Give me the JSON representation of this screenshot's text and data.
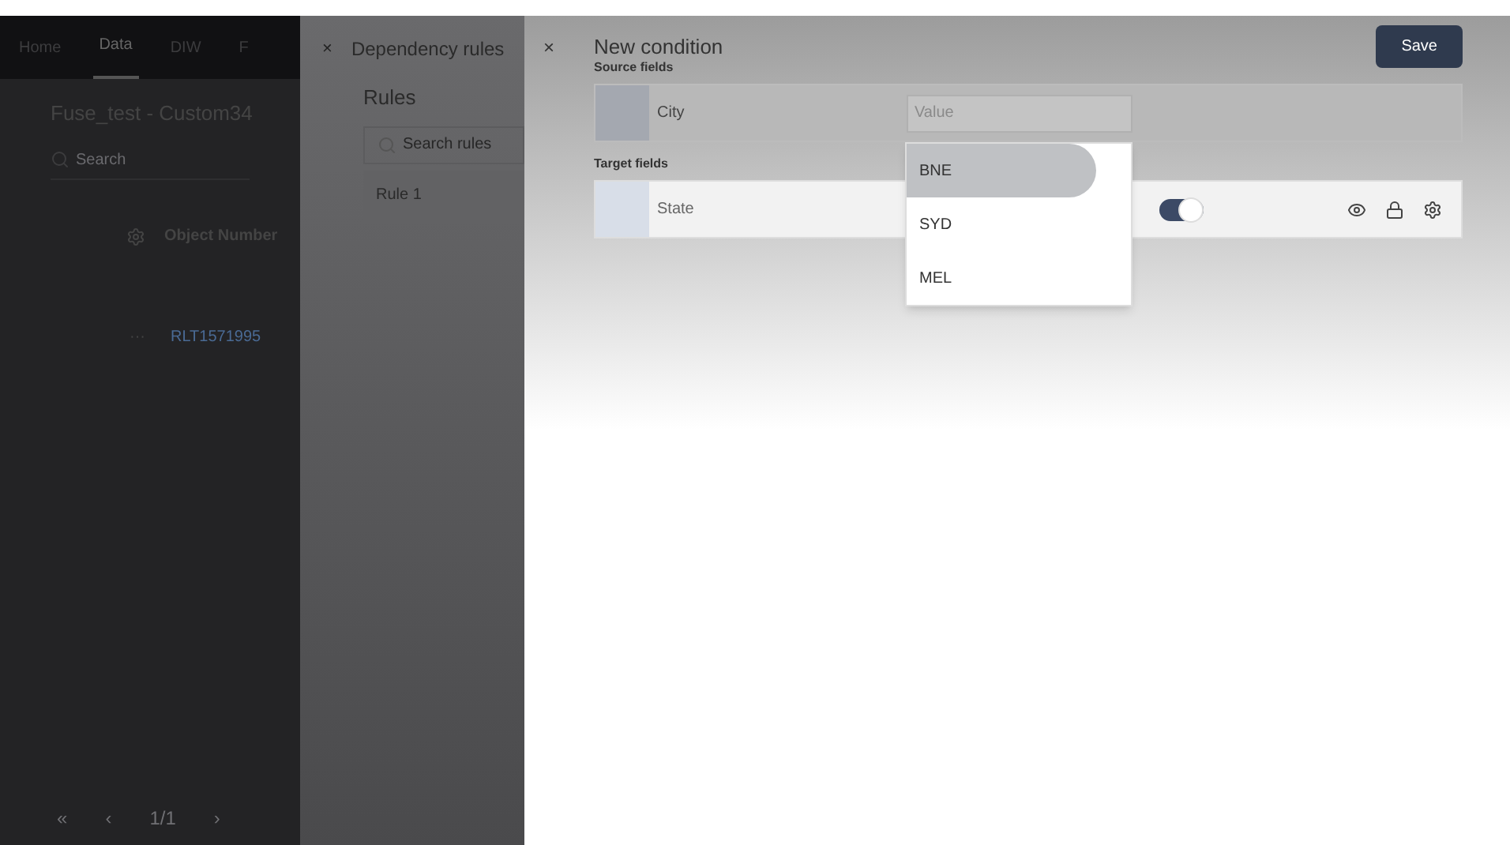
{
  "app_tabs": [
    {
      "label": "Home",
      "selected": false
    },
    {
      "label": "Data",
      "selected": true
    },
    {
      "label": "DIW",
      "selected": false
    },
    {
      "label": "F",
      "selected": false
    }
  ],
  "dataset_title": "Fuse_test - Custom34",
  "search": {
    "placeholder": "Search"
  },
  "table": {
    "columns": [
      "Object Number"
    ],
    "rows": [
      {
        "menu": "···",
        "object_number": "RLT1571995"
      }
    ]
  },
  "pagination": {
    "first": "«",
    "prev": "‹",
    "page": "1/1",
    "next": "›"
  },
  "rules_panel": {
    "close": "×",
    "title": "Dependency rules",
    "heading": "Rules",
    "search": {
      "placeholder": "Search rules"
    },
    "rules": [
      {
        "label": "Rule 1"
      }
    ]
  },
  "condition": {
    "close": "×",
    "title": "New condition",
    "save": "Save",
    "source_label": "Source fields",
    "source": {
      "name": "City",
      "value": {
        "placeholder": "Value"
      }
    },
    "target_label": "Target fields",
    "target": {
      "name": "State",
      "on": true
    },
    "options": [
      {
        "label": "BNE",
        "selected": true
      },
      {
        "label": "SYD",
        "selected": false
      },
      {
        "label": "MEL",
        "selected": false
      }
    ]
  }
}
